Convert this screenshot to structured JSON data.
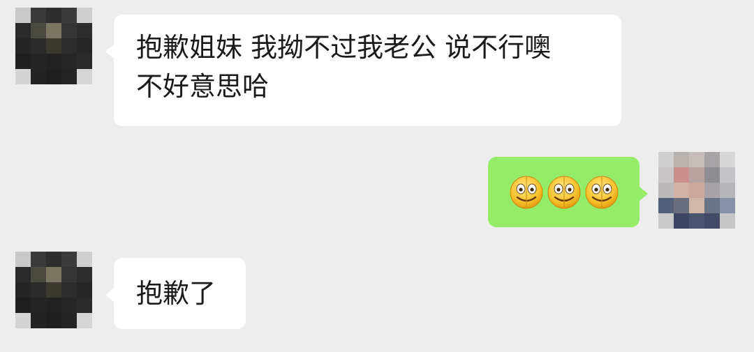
{
  "colors": {
    "background": "#ededed",
    "incoming_bubble": "#ffffff",
    "outgoing_bubble": "#95ec69",
    "text": "#1a1a1a"
  },
  "messages": [
    {
      "direction": "incoming",
      "avatar": "pixelated-avatar",
      "lines": [
        "抱歉姐妹 我拗不过我老公 说不行噢",
        "不好意思哈"
      ]
    },
    {
      "direction": "outgoing",
      "avatar": "pixelated-avatar",
      "emoji": [
        "melting-smile-emoji",
        "melting-smile-emoji",
        "melting-smile-emoji"
      ]
    },
    {
      "direction": "incoming",
      "avatar": "pixelated-avatar",
      "text": "抱歉了"
    }
  ]
}
